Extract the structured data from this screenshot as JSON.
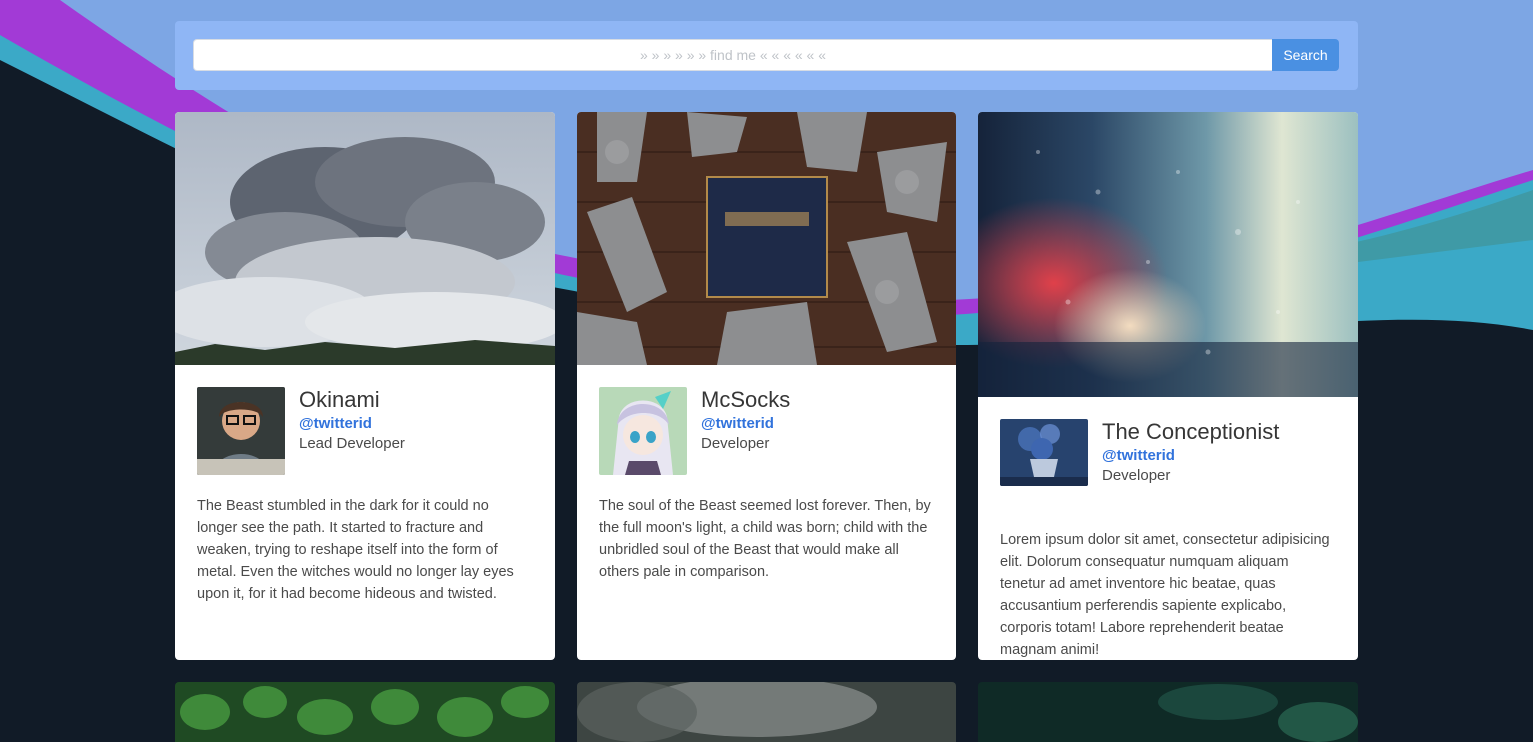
{
  "search": {
    "placeholder": "» » » » » » find me « « « « « «",
    "button_label": "Search"
  },
  "cards": [
    {
      "name": "Okinami",
      "handle": "@twitterid",
      "role": "Lead Developer",
      "description": "The Beast stumbled in the dark for it could no longer see the path. It started to fracture and weaken, trying to reshape itself into the form of metal. Even the witches would no longer lay eyes upon it, for it had become hideous and twisted."
    },
    {
      "name": "McSocks",
      "handle": "@twitterid",
      "role": "Developer",
      "description": "The soul of the Beast seemed lost forever. Then, by the full moon's light, a child was born; child with the unbridled soul of the Beast that would make all others pale in comparison."
    },
    {
      "name": "The Conceptionist",
      "handle": "@twitterid",
      "role": "Developer",
      "description": "Lorem ipsum dolor sit amet, consectetur adipisicing elit. Dolorum consequatur numquam aliquam tenetur ad amet inventore hic beatae, quas accusantium perferendis sapiente explicabo, corporis totam! Labore reprehenderit beatae magnam animi!"
    }
  ],
  "colors": {
    "background": "#111b27",
    "search_panel": "#8fb6f5",
    "search_button": "#4a90e2",
    "link": "#3273dc"
  }
}
